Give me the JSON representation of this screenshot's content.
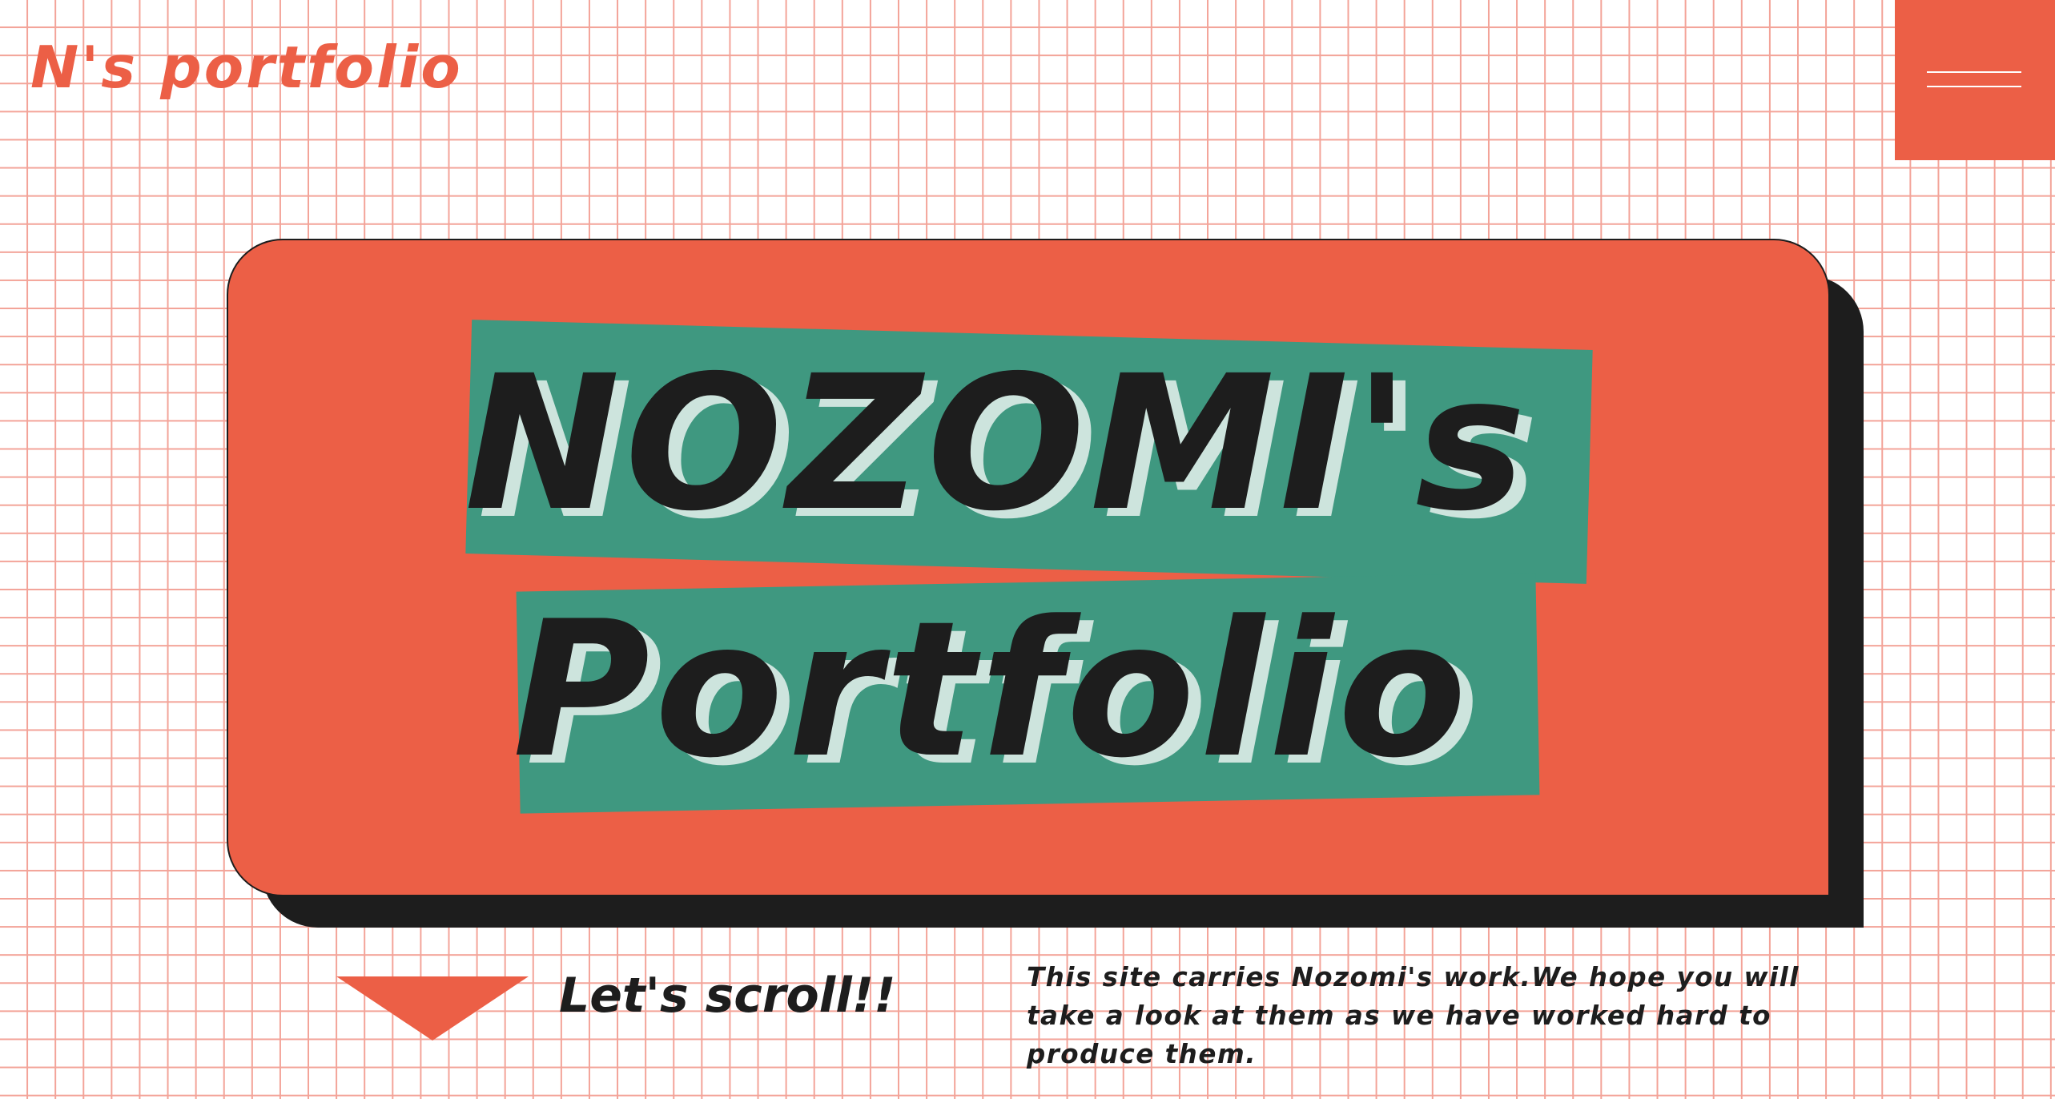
{
  "header": {
    "logo_text": "N's portfolio",
    "menu_icon": "hamburger-menu-icon"
  },
  "hero": {
    "title_line_1": "NOZOMI's",
    "title_line_2": "Portfolio"
  },
  "footer": {
    "scroll_label": "Let's scroll!!",
    "scroll_icon": "triangle-down-icon",
    "description": "This site carries Nozomi's work.We hope you will take a look at them as we have worked hard to produce them."
  },
  "colors": {
    "accent": "#ec5f46",
    "band_green": "#3f9880",
    "ink": "#1d1d1d",
    "title_shadow": "#cde4dd",
    "grid_line": "#f3a398",
    "background": "#ffffff"
  }
}
